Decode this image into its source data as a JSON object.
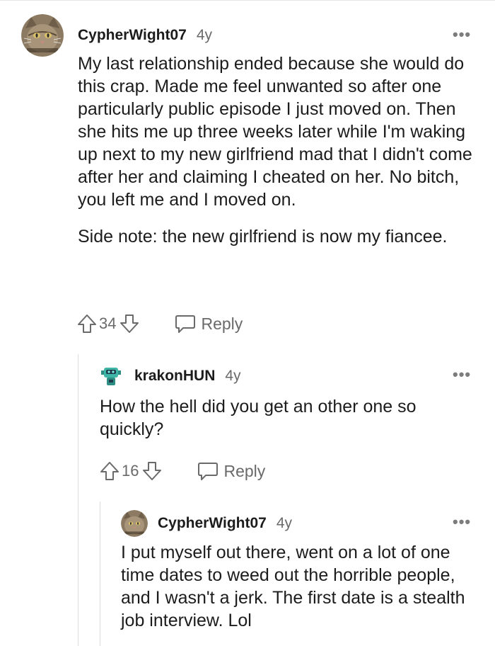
{
  "comments": [
    {
      "username": "CypherWight07",
      "age": "4y",
      "body": [
        "My last relationship ended because she would do this crap. Made me feel unwanted so after one particularly public episode I just moved on. Then she hits me up three weeks later while I'm waking up next to my new girlfriend mad that I didn't come after her and claiming I cheated on her. No bitch, you left me and I moved on.",
        "Side note: the new girlfriend is now my fiancee."
      ],
      "score": "34",
      "reply_label": "Reply",
      "avatar": "cat-avatar"
    },
    {
      "username": "krakonHUN",
      "age": "4y",
      "body": [
        "How the hell did you get an other one so quickly?"
      ],
      "score": "16",
      "reply_label": "Reply",
      "avatar": "robot-avatar"
    },
    {
      "username": "CypherWight07",
      "age": "4y",
      "body": [
        "I put myself out there, went on a lot of one time dates to weed out the horrible people, and I wasn't a jerk. The first date is a stealth job interview. Lol"
      ],
      "avatar": "cat-avatar"
    }
  ],
  "more_glyph": "•••",
  "colors": {
    "text": "#1c1c1c",
    "meta": "#6a6a6a",
    "thread_line": "#dcdcdc"
  }
}
